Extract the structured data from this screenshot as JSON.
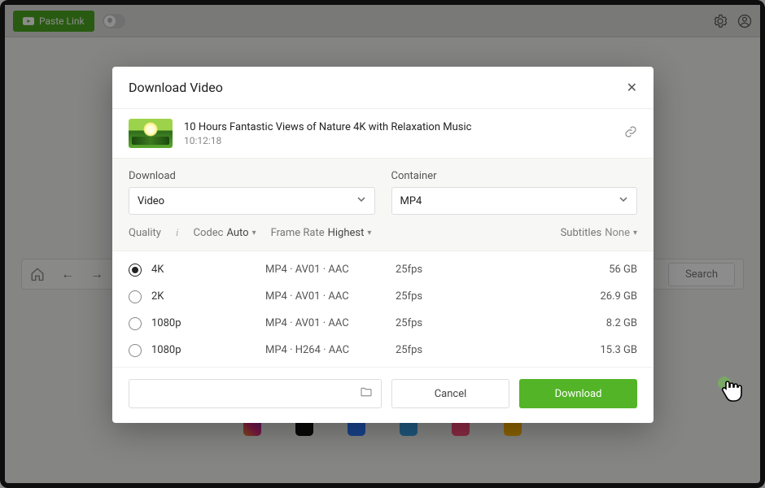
{
  "topbar": {
    "paste_label": "Paste Link"
  },
  "toolbar": {
    "search_label": "Search"
  },
  "modal": {
    "title": "Download Video",
    "video": {
      "title": "10 Hours Fantastic Views of Nature 4K with Relaxation Music",
      "duration": "10:12:18"
    },
    "options": {
      "download_label": "Download",
      "download_value": "Video",
      "container_label": "Container",
      "container_value": "MP4"
    },
    "filters": {
      "quality_label": "Quality",
      "codec_label": "Codec",
      "codec_value": "Auto",
      "framerate_label": "Frame Rate",
      "framerate_value": "Highest",
      "subtitles_label": "Subtitles",
      "subtitles_value": "None"
    },
    "quality_rows": [
      {
        "res": "4K",
        "fmt": "MP4 · AV01 · AAC",
        "fps": "25fps",
        "size": "56 GB",
        "selected": true
      },
      {
        "res": "2K",
        "fmt": "MP4 · AV01 · AAC",
        "fps": "25fps",
        "size": "26.9 GB",
        "selected": false
      },
      {
        "res": "1080p",
        "fmt": "MP4 · AV01 · AAC",
        "fps": "25fps",
        "size": "8.2 GB",
        "selected": false
      },
      {
        "res": "1080p",
        "fmt": "MP4 · H264 · AAC",
        "fps": "25fps",
        "size": "15.3 GB",
        "selected": false
      }
    ],
    "footer": {
      "cancel_label": "Cancel",
      "download_label": "Download"
    }
  }
}
